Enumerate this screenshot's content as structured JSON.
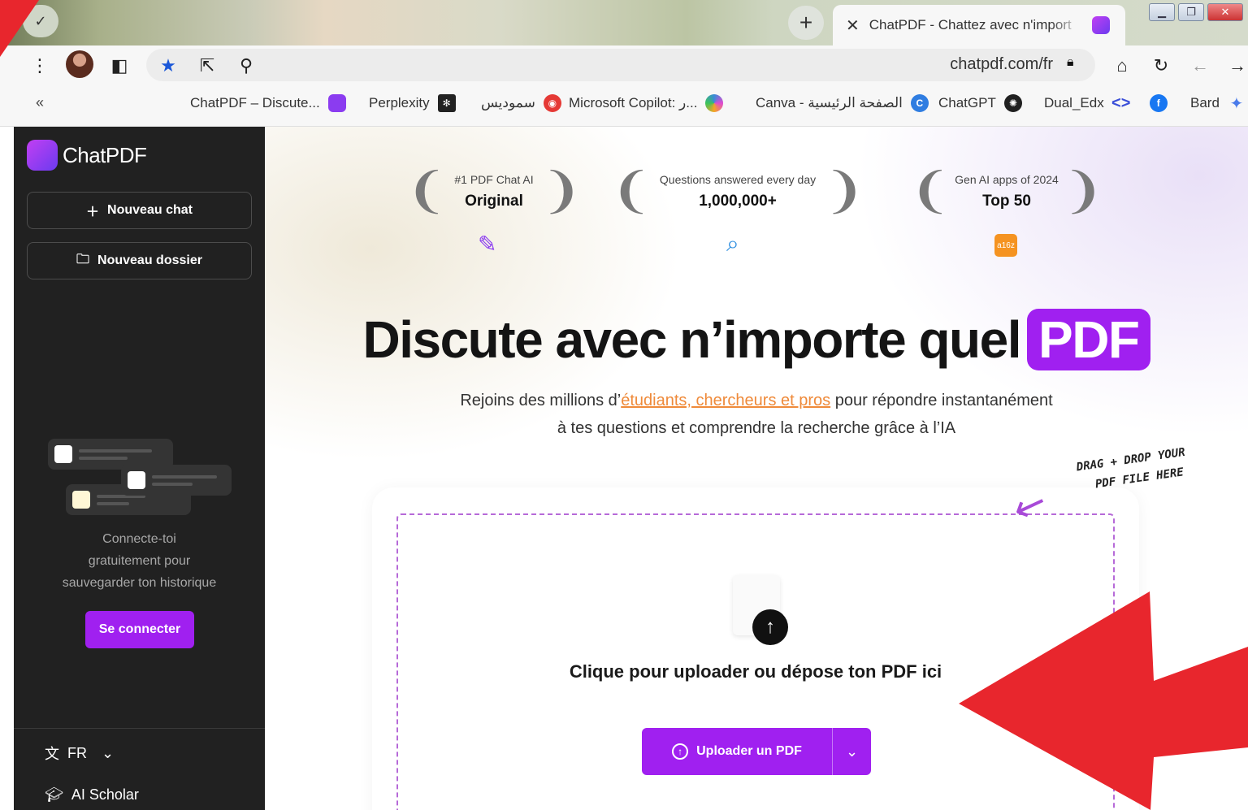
{
  "browser": {
    "tab_title": "ChatPDF - Chattez avec n'import",
    "url": "chatpdf.com/fr",
    "new_tab_symbol": "+",
    "close_symbol": "✕"
  },
  "bookmarks": [
    {
      "label": "ChatPDF – Discute...",
      "color": "#8b3cf0"
    },
    {
      "label": "Perplexity",
      "color": "#222222"
    },
    {
      "label": "سموديس",
      "color": "#e53935"
    },
    {
      "label": "Microsoft Copilot: ر...",
      "color": "#3a8bd8"
    },
    {
      "label": "Canva - الصفحة الرئيسية",
      "color": "#2f7de1"
    },
    {
      "label": "ChatGPT",
      "color": "#202020"
    },
    {
      "label": "Dual_Edx",
      "color": "#3b4fd8"
    },
    {
      "label": "Bard",
      "color": "#4a7bea"
    }
  ],
  "sidebar": {
    "logo": "ChatPDF",
    "new_chat": "Nouveau chat",
    "new_folder": "Nouveau dossier",
    "login_prompt_1": "Connecte-toi",
    "login_prompt_2": "gratuitement pour",
    "login_prompt_3": "sauvegarder ton historique",
    "login_button": "Se connecter",
    "language": "FR",
    "scholar": "AI Scholar"
  },
  "awards": [
    {
      "sub": "#1 PDF Chat AI",
      "main": "Original"
    },
    {
      "sub": "Questions answered every day",
      "main": "1,000,000+"
    },
    {
      "sub": "Gen AI apps of 2024",
      "main": "Top 50",
      "badge": "a16z"
    }
  ],
  "hero": {
    "headline": "Discute avec n’importe quel",
    "badge": "PDF",
    "sub_before": "Rejoins des millions d’",
    "sub_link": "étudiants, chercheurs et pros",
    "sub_after": " pour répondre instantanément",
    "sub_line2": "à tes questions et comprendre la recherche grâce à l’IA"
  },
  "upload": {
    "hint_1": "DRAG + DROP YOUR",
    "hint_2": "PDF FILE HERE",
    "drop_text": "Clique pour uploader ou dépose ton PDF ici",
    "button": "Uploader un PDF"
  },
  "colors": {
    "accent": "#a020f0",
    "sidebar_bg": "#212121",
    "link": "#ef8a3a",
    "annotation": "#e8262d"
  }
}
